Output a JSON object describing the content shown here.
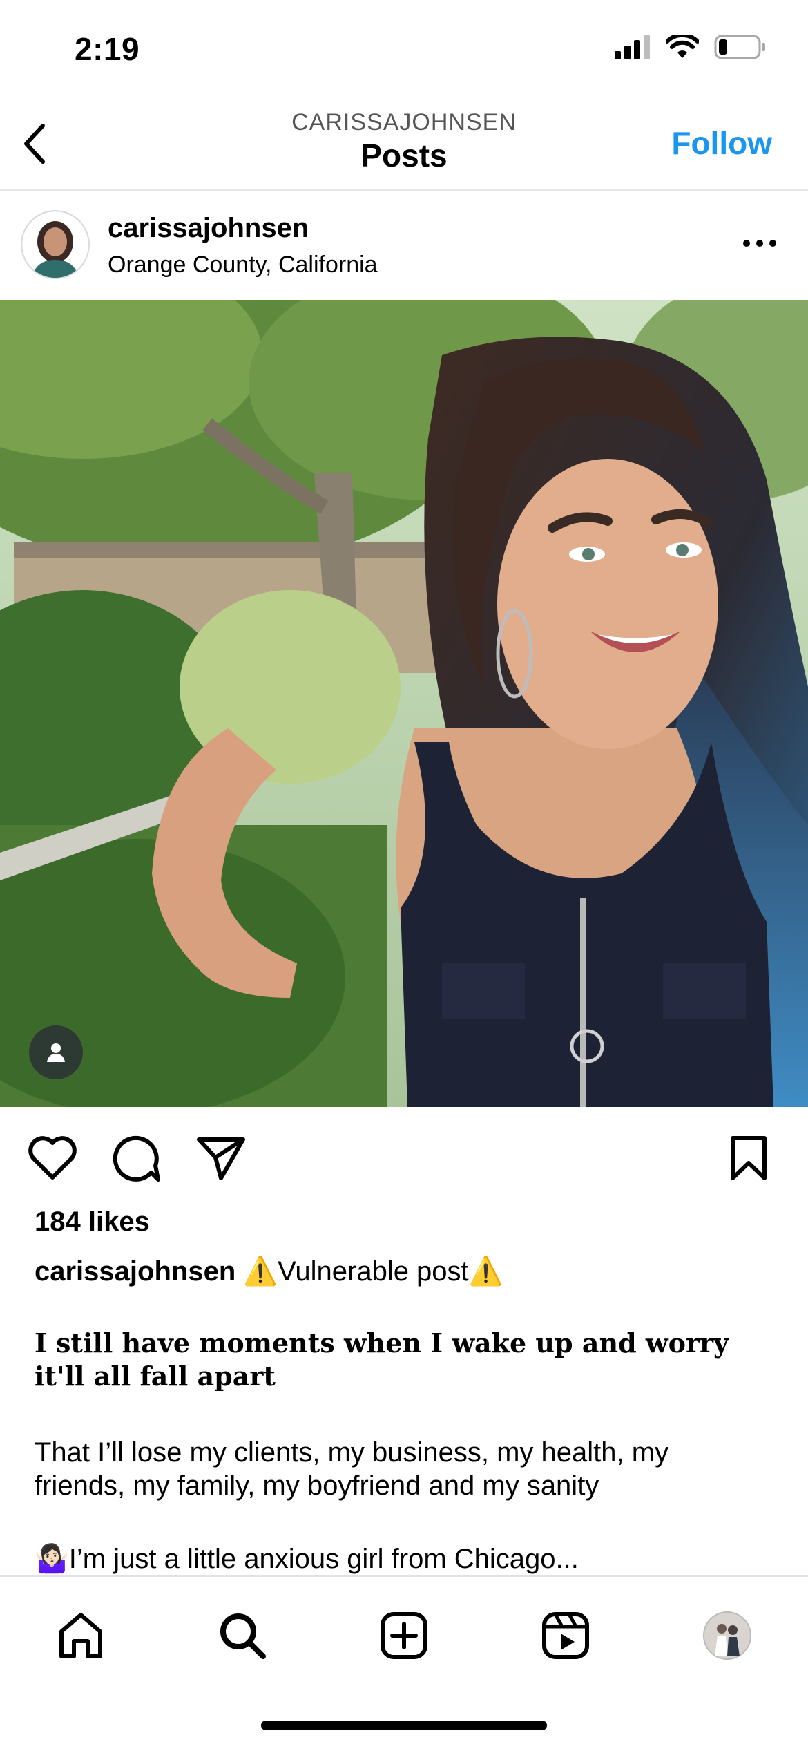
{
  "status_bar": {
    "time": "2:19"
  },
  "header": {
    "subtitle": "CARISSAJOHNSEN",
    "title": "Posts",
    "follow_label": "Follow"
  },
  "post": {
    "username": "carissajohnsen",
    "location": "Orange County, California",
    "likes": "184 likes",
    "caption": {
      "username": "carissajohnsen",
      "intro": "⚠️Vulnerable post⚠️",
      "heading": "I still have moments when I wake up and worry it'll all fall apart",
      "paragraph1": "That I’ll lose my clients, my business, my health, my friends, my family, my boyfriend and my sanity",
      "paragraph2": "🤷🏻‍♀️I’m just a little anxious girl from Chicago..."
    }
  },
  "icons": {
    "back": "chevron-left-icon",
    "more": "more-horizontal-icon",
    "tag": "person-tag-icon",
    "like": "heart-icon",
    "comment": "comment-icon",
    "share": "send-icon",
    "save": "bookmark-icon",
    "home": "home-icon",
    "search": "search-icon",
    "create": "plus-square-icon",
    "reels": "reels-icon",
    "profile": "profile-avatar"
  },
  "colors": {
    "accent": "#1a95f0",
    "text": "#000000",
    "secondary": "#555555",
    "divider": "#e6e6e6"
  }
}
